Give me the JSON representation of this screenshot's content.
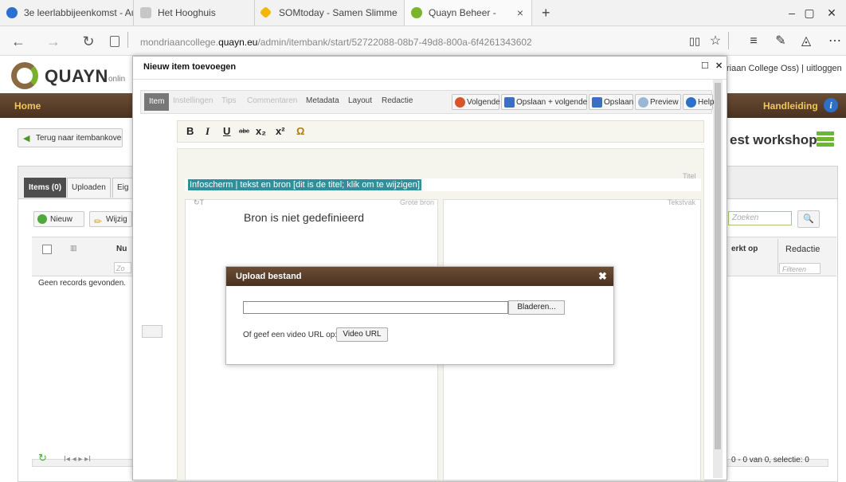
{
  "browser": {
    "tabs": [
      {
        "label": "3e leerlabbijeenkomst - Au",
        "color": "#2b6fd1"
      },
      {
        "label": "Het Hooghuis",
        "color": "#c6c6c6"
      },
      {
        "label": "SOMtoday - Samen Slimme",
        "color": "#f2b800"
      },
      {
        "label": "Quayn Beheer -",
        "color": "#7ab42c"
      }
    ],
    "tab_close": "×",
    "new_tab": "+",
    "window_controls": [
      "–",
      "▢",
      "✕"
    ],
    "url_prefix": "mondriaancollege.",
    "url_domain": "quayn.eu",
    "url_path": "/admin/itembank/start/52722088-08b7-49d8-800a-6f4261343602",
    "nav": {
      "back": "←",
      "forward": "→",
      "refresh": "↻",
      "lock": "🔒"
    }
  },
  "app": {
    "logo_text": "QUAYN",
    "logo_sub": "onlin",
    "user_info": "riaan College Oss)  |  uitloggen",
    "nav_home": "Home",
    "nav_manual": "Handleiding",
    "info_glyph": "i",
    "back_button": "Terug naar itembankoverz",
    "workshop_title": "est workshop",
    "panel_tabs": [
      "Items (0)",
      "Uploaden",
      "Eig"
    ],
    "btn_new": "Nieuw",
    "btn_edit": "Wijzig",
    "col_nr": "Nu",
    "col_zo": "Zo",
    "no_records": "Geen records gevonden.",
    "search_placeholder": "Zoeken",
    "col_werkt": "erkt op",
    "col_redactie": "Redactie",
    "filter_placeholder": "Filteren",
    "pager_text": "I◂  ◂   ▸  ▸I",
    "pager_status": "0 - 0 van 0,  selectie: 0"
  },
  "dialog": {
    "title": "Nieuw item toevoegen",
    "ctrl_max": "☐",
    "ctrl_close": "✕",
    "tabs": [
      {
        "label": "Instellingen",
        "enabled": false
      },
      {
        "label": "Tips",
        "enabled": false
      },
      {
        "label": "Commentaren",
        "enabled": false
      },
      {
        "label": "Metadata",
        "enabled": true
      },
      {
        "label": "Layout",
        "enabled": true
      },
      {
        "label": "Redactie",
        "enabled": true
      }
    ],
    "tab_item": "Item",
    "btn_next": "Volgende",
    "btn_save_next": "Opslaan + volgende",
    "btn_save": "Opslaan",
    "btn_preview": "Preview",
    "btn_help": "Help",
    "format_buttons": [
      "B",
      "I",
      "U",
      "abc",
      "x₂",
      "x²",
      "Ω"
    ],
    "titel_label": "Titel",
    "title_text": "Infoscherm | tekst en bron [dit is de titel; klik om te wijzigen]",
    "grote_bron_label": "Grote bron",
    "tekstvak_label": "Tekstvak",
    "bron_placeholder": "Bron is niet gedefinieerd"
  },
  "upload": {
    "title": "Upload bestand",
    "close": "✖",
    "browse": "Bladeren...",
    "video_label": "Of geef een video URL op:",
    "video_button": "Video URL"
  }
}
